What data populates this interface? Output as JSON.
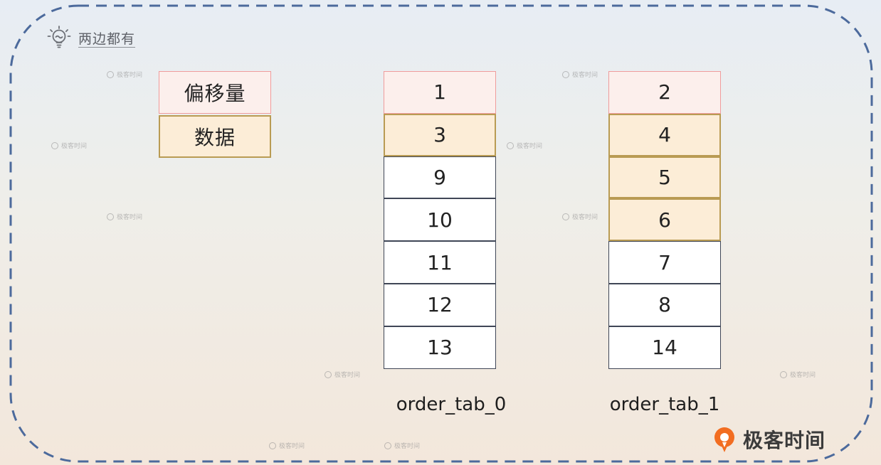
{
  "header": {
    "title": "两边都有",
    "icon": "lightbulb-icon"
  },
  "legend": {
    "offset_label": "偏移量",
    "data_label": "数据"
  },
  "tables": [
    {
      "name": "order_tab_0",
      "cells": [
        {
          "value": "1",
          "kind": "offset"
        },
        {
          "value": "3",
          "kind": "data"
        },
        {
          "value": "9",
          "kind": "plain"
        },
        {
          "value": "10",
          "kind": "plain"
        },
        {
          "value": "11",
          "kind": "plain"
        },
        {
          "value": "12",
          "kind": "plain"
        },
        {
          "value": "13",
          "kind": "plain"
        }
      ]
    },
    {
      "name": "order_tab_1",
      "cells": [
        {
          "value": "2",
          "kind": "offset"
        },
        {
          "value": "4",
          "kind": "data"
        },
        {
          "value": "5",
          "kind": "data"
        },
        {
          "value": "6",
          "kind": "data"
        },
        {
          "value": "7",
          "kind": "plain"
        },
        {
          "value": "8",
          "kind": "plain"
        },
        {
          "value": "14",
          "kind": "plain"
        }
      ]
    }
  ],
  "watermark_text": "极客时间",
  "brand": {
    "name": "极客时间",
    "logo": "geektime-logo-icon"
  },
  "colors": {
    "offset_fill": "#fcefec",
    "offset_border": "#ef9c9c",
    "data_fill": "#fcedd7",
    "data_border": "#b99b53",
    "frame_dash": "#4c6a9c",
    "brand_orange": "#f26d21"
  }
}
